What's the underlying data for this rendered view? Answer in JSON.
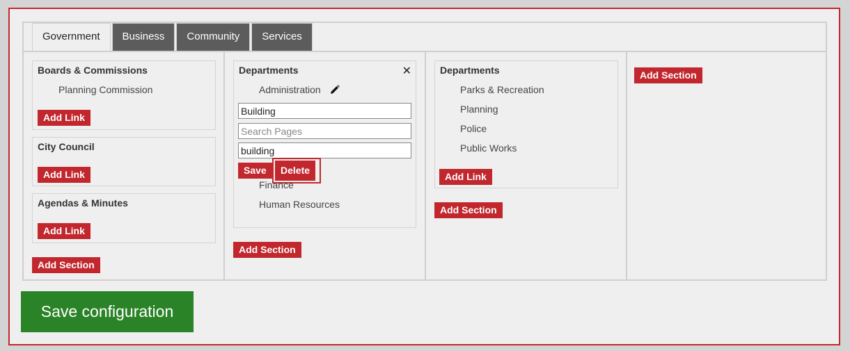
{
  "tabs": [
    {
      "label": "Government",
      "active": true
    },
    {
      "label": "Business"
    },
    {
      "label": "Community"
    },
    {
      "label": "Services"
    }
  ],
  "col1": {
    "sections": [
      {
        "title": "Boards & Commissions",
        "links": [
          "Planning Commission"
        ],
        "add_link": "Add Link"
      },
      {
        "title": "City Council",
        "add_link": "Add Link"
      },
      {
        "title": "Agendas & Minutes",
        "add_link": "Add Link"
      }
    ],
    "add_section": "Add Section"
  },
  "col2": {
    "section_title": "Departments",
    "link_admin": "Administration",
    "edit": {
      "title_value": "Building",
      "search_placeholder": "Search Pages",
      "url_value": "building",
      "save": "Save",
      "delete": "Delete"
    },
    "links": [
      "Finance",
      "Human Resources"
    ],
    "add_section": "Add Section"
  },
  "col3": {
    "section_title": "Departments",
    "links": [
      "Parks & Recreation",
      "Planning",
      "Police",
      "Public Works"
    ],
    "add_link": "Add Link",
    "add_section": "Add Section"
  },
  "col4": {
    "add_section": "Add Section"
  },
  "save_configuration": "Save configuration"
}
